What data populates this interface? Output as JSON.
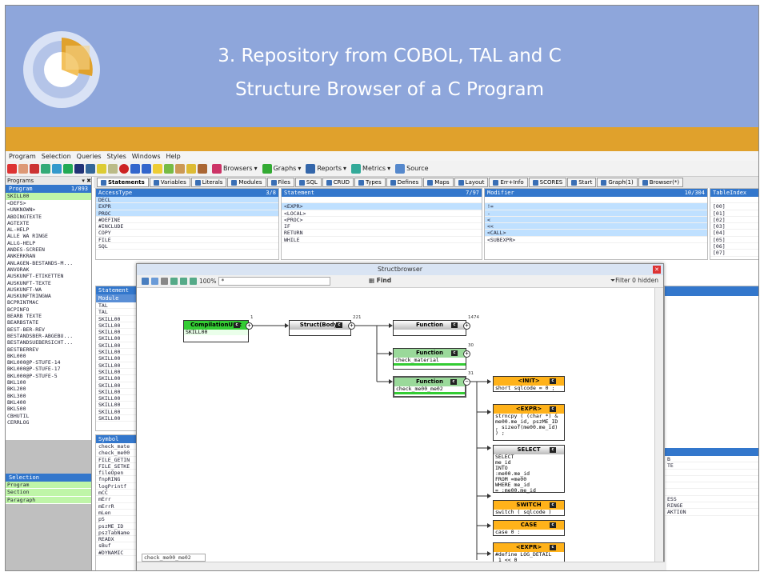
{
  "slide": {
    "title_line1": "3. Repository from COBOL, TAL and C",
    "title_line2": "Structure Browser of a C Program",
    "colors": {
      "banner": "#8ea6db",
      "accent": "#e0a12c"
    }
  },
  "app": {
    "menu": [
      "Program",
      "Selection",
      "Queries",
      "Styles",
      "Windows",
      "Help"
    ],
    "toolbar_dropdowns": [
      "Browsers",
      "Graphs",
      "Reports",
      "Metrics",
      "Source"
    ],
    "tabs": [
      "Statements",
      "Variables",
      "Literals",
      "Modules",
      "Files",
      "SQL",
      "CRUD",
      "Types",
      "Defines",
      "Maps",
      "Layout",
      "Err+Info",
      "SCORES",
      "Start",
      "Graph(1)",
      "Browser(*)"
    ],
    "left": {
      "panel_title": "Programs",
      "panel_title_controls": "▾ ✖",
      "header_label": "Program",
      "header_count": "1/893",
      "selected": "SKILL00",
      "programs": [
        "<DEFS>",
        "<UNKNOWN>",
        "ABDINGTEXTE",
        "AGTEXTE",
        "AL-HELP",
        "ALLE WA RINGE",
        "ALLG-HELP",
        "ANDES-SCREEN",
        "ANKERKRAN",
        "ANLAGEN-BESTANDS-M...",
        "ANVORAK",
        "AUSKUNFT-ETIKETTEN",
        "AUSKUNFT-TEXTE",
        "AUSKUNFT-WA",
        "AUSKUNFTRINGWA",
        "BCPRINTMAC",
        "BCPINFO",
        "BEARB TEXTE",
        "BEARBSTATE",
        "BEST-BER-REV",
        "BESTANDSBER-ABGEBU...",
        "BESTANDSUEBERSICHT...",
        "BESTBERREV",
        "BKL000",
        "BKL000@P-STUFE-14",
        "BKL000@P-STUFE-17",
        "BKL000@P-STUFE-5",
        "BKL100",
        "BKL200",
        "BKL300",
        "BKL400",
        "BKL500",
        "CBHUTIL",
        "CERRLOG"
      ],
      "selection_header": "Selection",
      "selection_items": [
        "Program",
        "Section",
        "Paragraph"
      ]
    },
    "access_panel": {
      "header": "AccessType",
      "count": "3/8",
      "rows": [
        "DECL",
        "EXPR",
        "PROC",
        "#DEFINE",
        "#INCLUDE",
        "COPY",
        "FILE",
        "SQL"
      ]
    },
    "statement_panel": {
      "header": "Statement",
      "count": "7/97",
      "rows": [
        "",
        "<EXPR>",
        "<LOCAL>",
        "<PROC>",
        "IF",
        "RETURN",
        "WHILE"
      ]
    },
    "modifier_panel": {
      "header": "Modifier",
      "count": "10/304",
      "rows": [
        "",
        "!=",
        "-",
        "<",
        "<<",
        "<CALL>",
        "<SUBEXPR>"
      ]
    },
    "tableindex_panel": {
      "header": "TableIndex",
      "rows": [
        "",
        "[00]",
        "[01]",
        "[02]",
        "[03]",
        "[04]",
        "[05]",
        "[06]",
        "[07]"
      ]
    },
    "statement_module_panel": {
      "header": "Statement",
      "subheader": "Module",
      "rows": [
        "TAL",
        "TAL",
        "SKILL00",
        "SKILL00",
        "SKILL00",
        "SKILL00",
        "SKILL00",
        "SKILL00",
        "SKILL00",
        "SKILL00",
        "SKILL00",
        "SKILL00",
        "SKILL00",
        "SKILL00",
        "SKILL00",
        "SKILL00",
        "SKILL00",
        "SKILL00"
      ]
    },
    "symbol_panel": {
      "header": "Symbol",
      "rows": [
        "check_mate",
        "check_me00",
        "FILE_GETIN",
        "FILE_SETKE",
        "fileOpen",
        "fnpRING",
        "logPrintf",
        "mCC",
        "mErr",
        "mErrR",
        "mLen",
        "pS",
        "pszME_ID",
        "pszTabName",
        "READX",
        "sBuf",
        "#DYNAMIC"
      ]
    },
    "right_strip": {
      "rows": [
        "B",
        "TE",
        "",
        "",
        "",
        "",
        "ESS",
        "RINGE",
        "AKTION"
      ]
    }
  },
  "structbrowser": {
    "title": "Structbrowser",
    "zoom": "100%",
    "zoom_box_value": "*",
    "find_label": "Find",
    "filter_label": "Filter 0 hidden",
    "status_value": "check_me00_me02",
    "nodes": {
      "cu": {
        "title": "CompilationUnit",
        "body": "SKILL00",
        "count": "1"
      },
      "struct": {
        "title": "Struct(Body)",
        "count": "221"
      },
      "func1": {
        "title": "Function",
        "count": "1474"
      },
      "func2": {
        "title": "Function",
        "body": "check_material",
        "count": "30"
      },
      "func3": {
        "title": "Function",
        "body": "check_me00_me02",
        "count": "31"
      },
      "init": {
        "title": "<INIT>",
        "body": "short sqlcode = 0 ;"
      },
      "expr1": {
        "title": "<EXPR>",
        "body": "strncpy ( (char *) &\nme00.me_id, pszME_ID\n, sizeof(me00.me_id)\n) ;"
      },
      "select": {
        "title": "SELECT",
        "body": "SELECT\nme_id\nINTO\n:me00.me_id\nFROM =me00\nWHERE me_id\n= :me00.me_id"
      },
      "switch": {
        "title": "SWITCH",
        "body": "switch ( sqlcode )"
      },
      "case": {
        "title": "CASE",
        "body": "case 0 :"
      },
      "expr2": {
        "title": "<EXPR>",
        "body": "#define LOG_DETAIL\n 1 << 0"
      }
    }
  }
}
